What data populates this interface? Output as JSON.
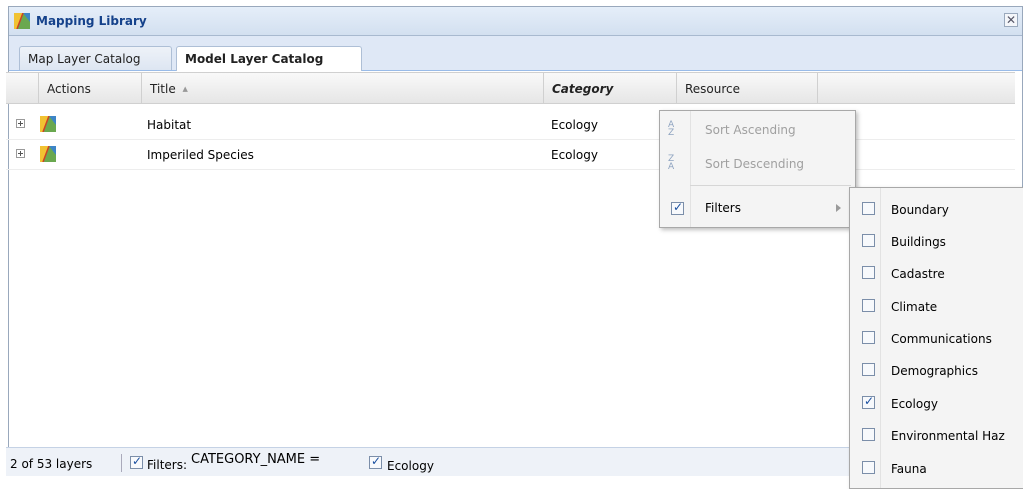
{
  "window": {
    "title": "Mapping Library",
    "close_glyph": "✕"
  },
  "tabs": [
    {
      "label": "Map Layer Catalog",
      "active": false
    },
    {
      "label": "Model Layer Catalog",
      "active": true
    }
  ],
  "grid": {
    "columns": {
      "actions": "Actions",
      "title": "Title",
      "title_sort": "▲",
      "category": "Category",
      "resource": "Resource"
    },
    "rows": [
      {
        "title": "Habitat",
        "category": "Ecology"
      },
      {
        "title": "Imperiled Species",
        "category": "Ecology"
      }
    ]
  },
  "column_menu": {
    "sort_asc": "Sort Ascending",
    "sort_desc": "Sort Descending",
    "filters": "Filters",
    "filters_checked": true
  },
  "filter_menu": {
    "items": [
      {
        "label": "Boundary",
        "checked": false
      },
      {
        "label": "Buildings",
        "checked": false
      },
      {
        "label": "Cadastre",
        "checked": false
      },
      {
        "label": "Climate",
        "checked": false
      },
      {
        "label": "Communications",
        "checked": false
      },
      {
        "label": "Demographics",
        "checked": false
      },
      {
        "label": "Ecology",
        "checked": true
      },
      {
        "label": "Environmental Haz",
        "checked": false
      },
      {
        "label": "Fauna",
        "checked": false
      }
    ]
  },
  "statusbar": {
    "count": "2 of 53 layers",
    "filters_label": "Filters:",
    "filter_expr": "CATEGORY_NAME =",
    "filter_value": "Ecology"
  },
  "colors": {
    "accent": "#15428b",
    "tab_bg": "#dfe8f6",
    "header_border": "#99bbe8"
  }
}
